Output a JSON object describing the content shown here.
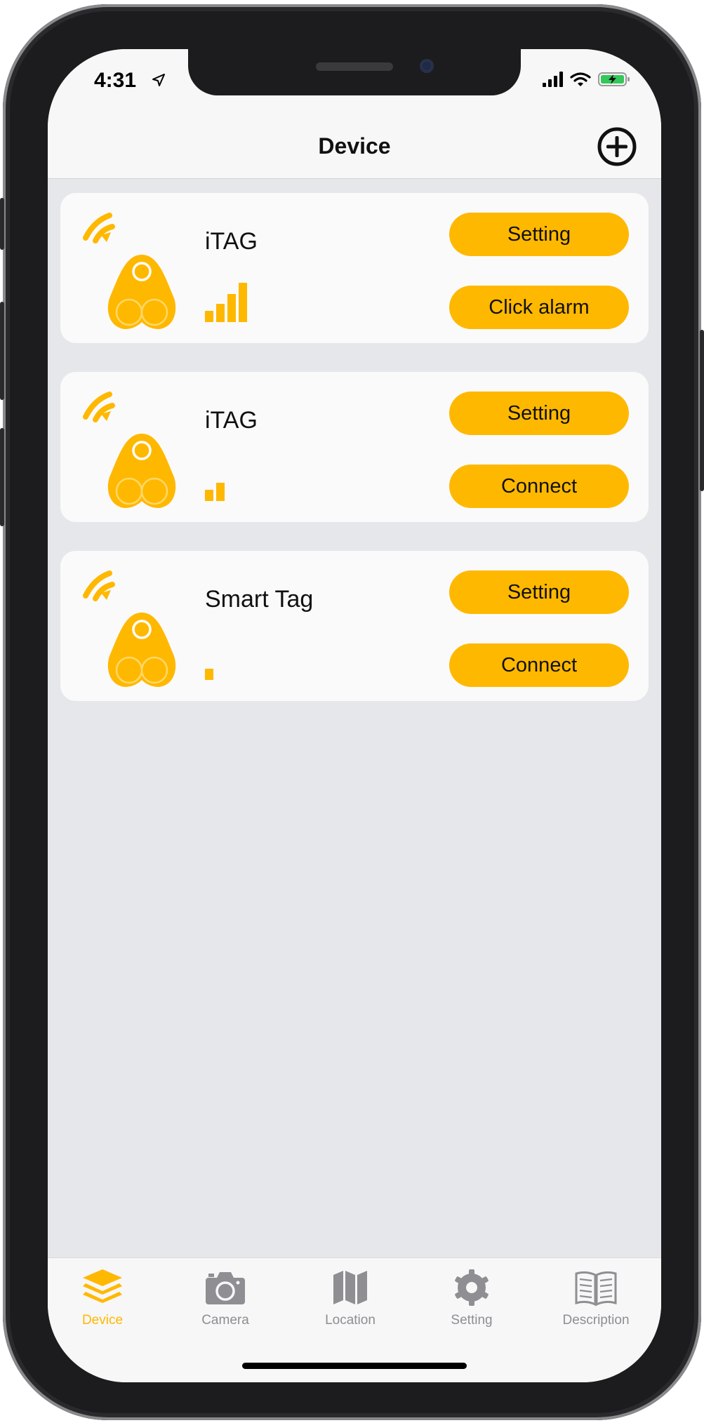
{
  "status_bar": {
    "time": "4:31",
    "icons": [
      "location-arrow-icon",
      "cellular-signal-icon",
      "wifi-icon",
      "battery-charging-icon"
    ]
  },
  "nav": {
    "title": "Device",
    "add_icon": "plus-circle-icon"
  },
  "devices": [
    {
      "name": "iTAG",
      "signal_bars": 4,
      "setting_label": "Setting",
      "action_label": "Click alarm"
    },
    {
      "name": "iTAG",
      "signal_bars": 2,
      "setting_label": "Setting",
      "action_label": "Connect"
    },
    {
      "name": "Smart Tag",
      "signal_bars": 1,
      "setting_label": "Setting",
      "action_label": "Connect"
    }
  ],
  "tabs": [
    {
      "label": "Device",
      "icon": "layers-icon",
      "active": true
    },
    {
      "label": "Camera",
      "icon": "camera-icon",
      "active": false
    },
    {
      "label": "Location",
      "icon": "map-icon",
      "active": false
    },
    {
      "label": "Setting",
      "icon": "gear-icon",
      "active": false
    },
    {
      "label": "Description",
      "icon": "book-icon",
      "active": false
    }
  ],
  "colors": {
    "accent": "#ffb800",
    "background": "#e6e7ea",
    "card": "#fafafa",
    "bar": "#f7f7f7",
    "inactive_tab": "#8e8e93"
  }
}
